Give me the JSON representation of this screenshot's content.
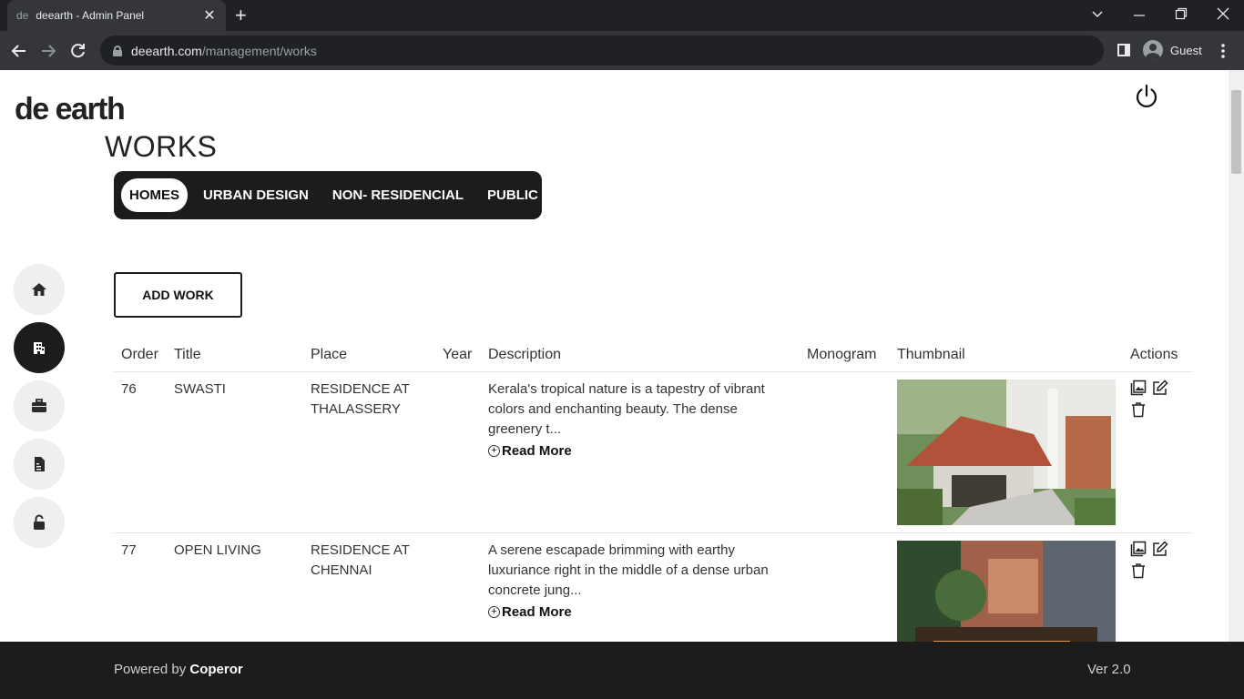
{
  "browser": {
    "tab_favicon": "de",
    "tab_title": "deearth - Admin Panel",
    "tab_close": "✕",
    "new_tab": "+",
    "url_host": "deearth.com",
    "url_path": "/management/works",
    "profile_name": "Guest"
  },
  "header": {
    "logo": "de earth",
    "page_title": "WORKS"
  },
  "categories": {
    "tabs": [
      "HOMES",
      "URBAN DESIGN",
      "NON- RESIDENCIAL",
      "PUBLIC"
    ],
    "active": "HOMES"
  },
  "sidebar": {
    "items": [
      "home-icon",
      "building-icon",
      "briefcase-icon",
      "document-icon",
      "unlock-icon"
    ],
    "active_index": 1
  },
  "add_work_label": "ADD WORK",
  "table": {
    "headers": [
      "Order",
      "Title",
      "Place",
      "Year",
      "Description",
      "Monogram",
      "Thumbnail",
      "Actions"
    ],
    "read_more": "Read More",
    "rows": [
      {
        "order": "76",
        "title": "SWASTI",
        "place": "RESIDENCE AT THALASSERY",
        "year": "",
        "description": "Kerala's tropical nature is a tapestry of vibrant colors and enchanting beauty. The dense greenery t...",
        "monogram": ""
      },
      {
        "order": "77",
        "title": "OPEN LIVING",
        "place": "RESIDENCE AT CHENNAI",
        "year": "",
        "description": "A serene escapade brimming with earthy luxuriance right in the middle of a dense urban concrete jung...",
        "monogram": ""
      }
    ]
  },
  "footer": {
    "powered_prefix": "Powered by ",
    "powered_brand": "Coperor",
    "version": "Ver 2.0"
  }
}
